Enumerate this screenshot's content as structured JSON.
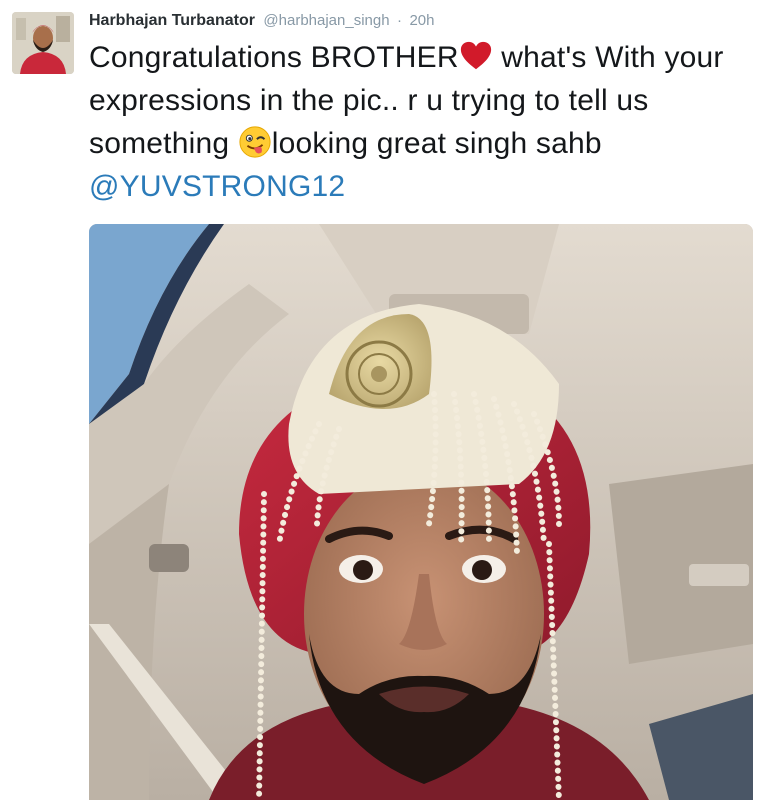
{
  "tweet": {
    "author_name": "Harbhajan Turbanator",
    "handle": "@harbhajan_singh",
    "separator": "·",
    "time": "20h",
    "text_part1": "Congratulations BROTHER",
    "text_part2": " what's With your expressions in the pic.. r u trying to tell us something ",
    "text_part3": "looking great singh sahb ",
    "mention": "@YUVSTRONG12",
    "colors": {
      "name": "#292f33",
      "meta": "#8899a6",
      "text": "#14171a",
      "mention": "#2b7bb9",
      "heart": "#d11a2a"
    }
  },
  "icons": {
    "heart": "red-heart-icon",
    "wink": "winking-face-with-tongue-icon"
  }
}
